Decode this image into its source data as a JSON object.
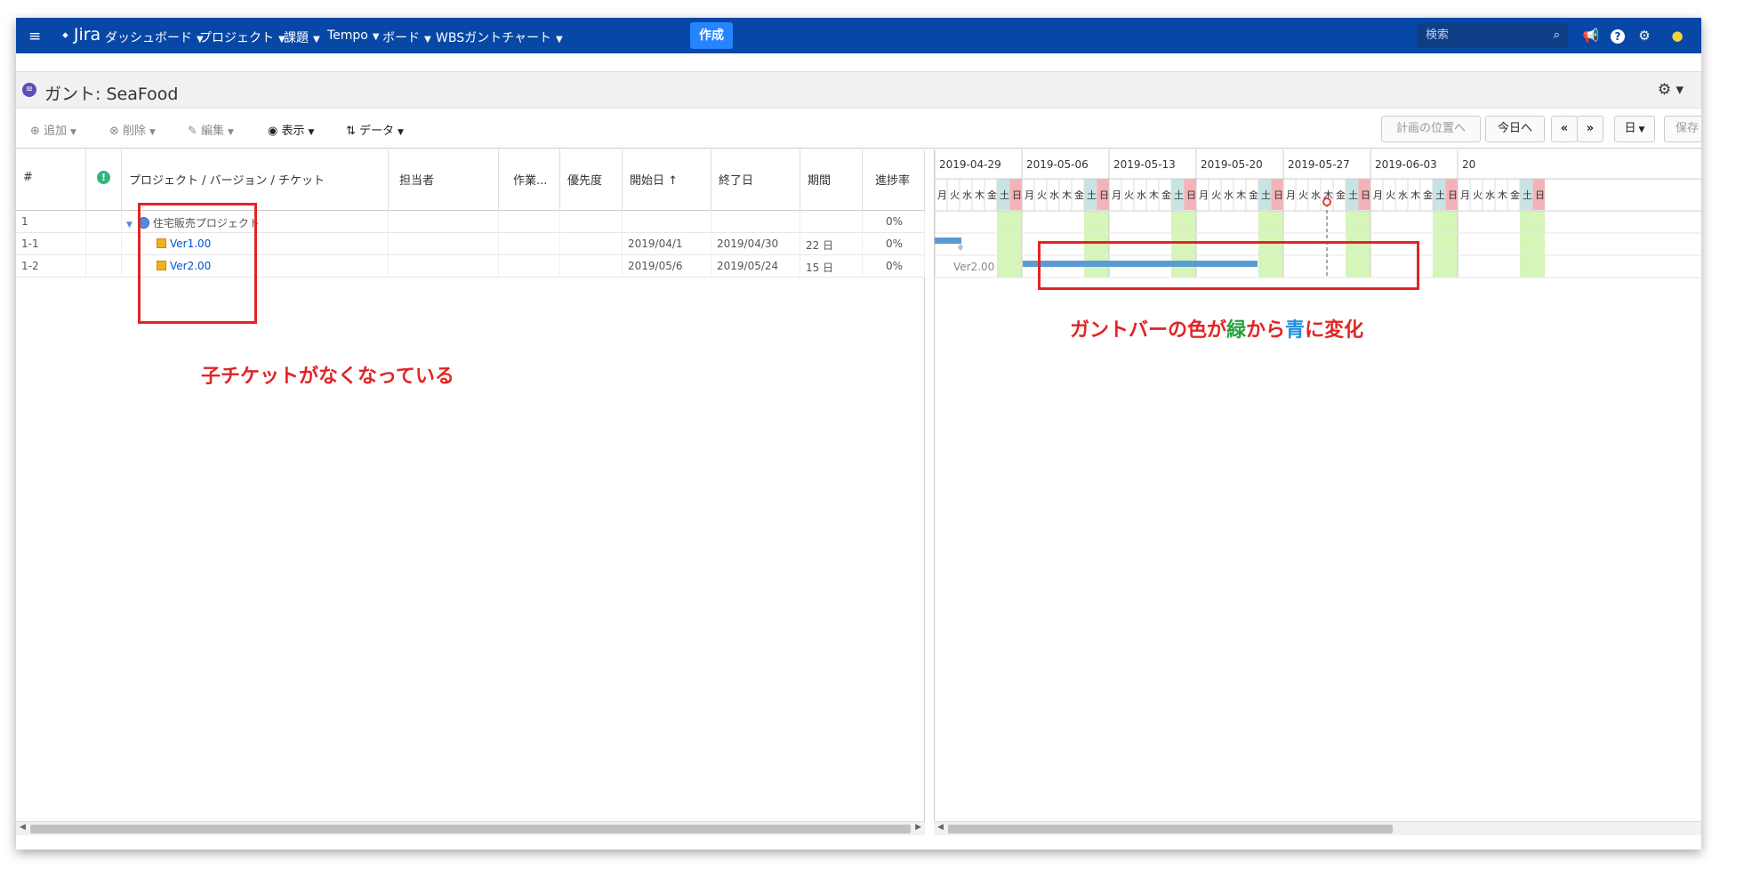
{
  "nav": {
    "app_name": "Jira",
    "items": [
      {
        "label": "ダッシュボード"
      },
      {
        "label": "プロジェクト"
      },
      {
        "label": "課題"
      },
      {
        "label": "Tempo"
      },
      {
        "label": "ボード"
      },
      {
        "label": "WBSガントチャート"
      }
    ],
    "create_label": "作成",
    "search_placeholder": "検索"
  },
  "page": {
    "title": "ガント: SeaFood"
  },
  "toolbar": {
    "add": "追加",
    "delete": "削除",
    "edit": "編集",
    "view": "表示",
    "data": "データ",
    "plan_position": "計画の位置へ",
    "today": "今日へ",
    "prev": "«",
    "next": "»",
    "scale": "日",
    "save": "保存"
  },
  "grid": {
    "columns": [
      "#",
      "!",
      "プロジェクト / バージョン / チケット",
      "担当者",
      "作業...",
      "優先度",
      "開始日 ↑",
      "終了日",
      "期間",
      "進捗率"
    ],
    "rows": [
      {
        "num": "1",
        "name": "住宅販売プロジェクト",
        "start": "",
        "end": "",
        "duration": "",
        "progress": "0%"
      },
      {
        "num": "1-1",
        "name": "Ver1.00",
        "start": "2019/04/1",
        "end": "2019/04/30",
        "duration": "22 日",
        "progress": "0%"
      },
      {
        "num": "1-2",
        "name": "Ver2.00",
        "start": "2019/05/6",
        "end": "2019/05/24",
        "duration": "15 日",
        "progress": "0%"
      }
    ]
  },
  "gantt": {
    "weeks": [
      "2019-04-29",
      "2019-05-06",
      "2019-05-13",
      "2019-05-20",
      "2019-05-27",
      "2019-06-03",
      "20"
    ],
    "weekdays": [
      "月",
      "火",
      "水",
      "木",
      "金",
      "土",
      "日"
    ],
    "bar_label": "Ver2.00",
    "colors": {
      "bar": "#5b9bd5",
      "weekend": "#d6f5b8",
      "today": "#e53935",
      "sat_header": "#c7e3e3",
      "sun_header": "#f4b3b8"
    }
  },
  "annotations": {
    "left": "子チケットがなくなっている",
    "right_parts": [
      "ガントバーの色が",
      "緑",
      "から",
      "青",
      "に変化"
    ]
  }
}
